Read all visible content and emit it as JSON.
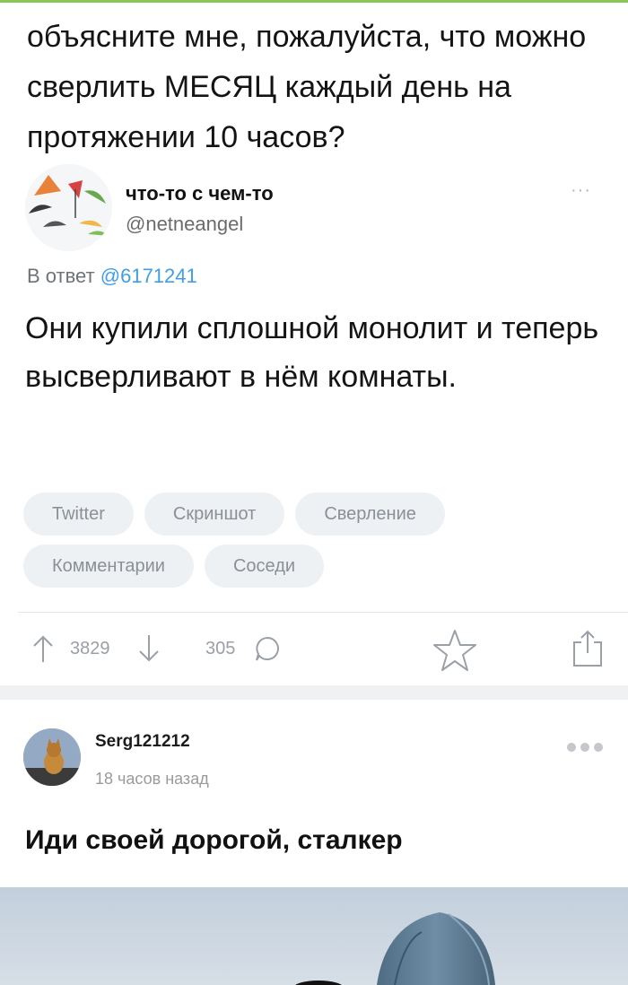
{
  "tweet": {
    "question": "объясните мне, пожалуйста, что можно сверлить МЕСЯЦ каждый день на протяжении 10 часов?",
    "author_name": "что-то с чем-то",
    "author_handle": "@netneangel",
    "more": "···",
    "reply_prefix": "В ответ",
    "reply_to": "@6171241",
    "reply_text": "Они купили сплошной монолит и теперь высверливают в нём комнаты."
  },
  "tags": {
    "row1": [
      "Twitter",
      "Скриншот",
      "Сверление"
    ],
    "row2": [
      "Комментарии",
      "Соседи"
    ]
  },
  "actions": {
    "rating": "3829",
    "comments": "305",
    "upvote_icon": "arrow-up-icon",
    "downvote_icon": "arrow-down-icon",
    "comment_icon": "speech-bubble-icon",
    "save_icon": "star-icon",
    "share_icon": "share-icon"
  },
  "comment": {
    "username": "Serg121212",
    "time": "18 часов назад",
    "text": "Иди своей дорогой, сталкер"
  },
  "colors": {
    "accent": "#8ac858",
    "link": "#3f9ee8",
    "tag_bg": "#eef1f4",
    "tag_text": "#8b9097",
    "icon": "#9aa0a6"
  }
}
